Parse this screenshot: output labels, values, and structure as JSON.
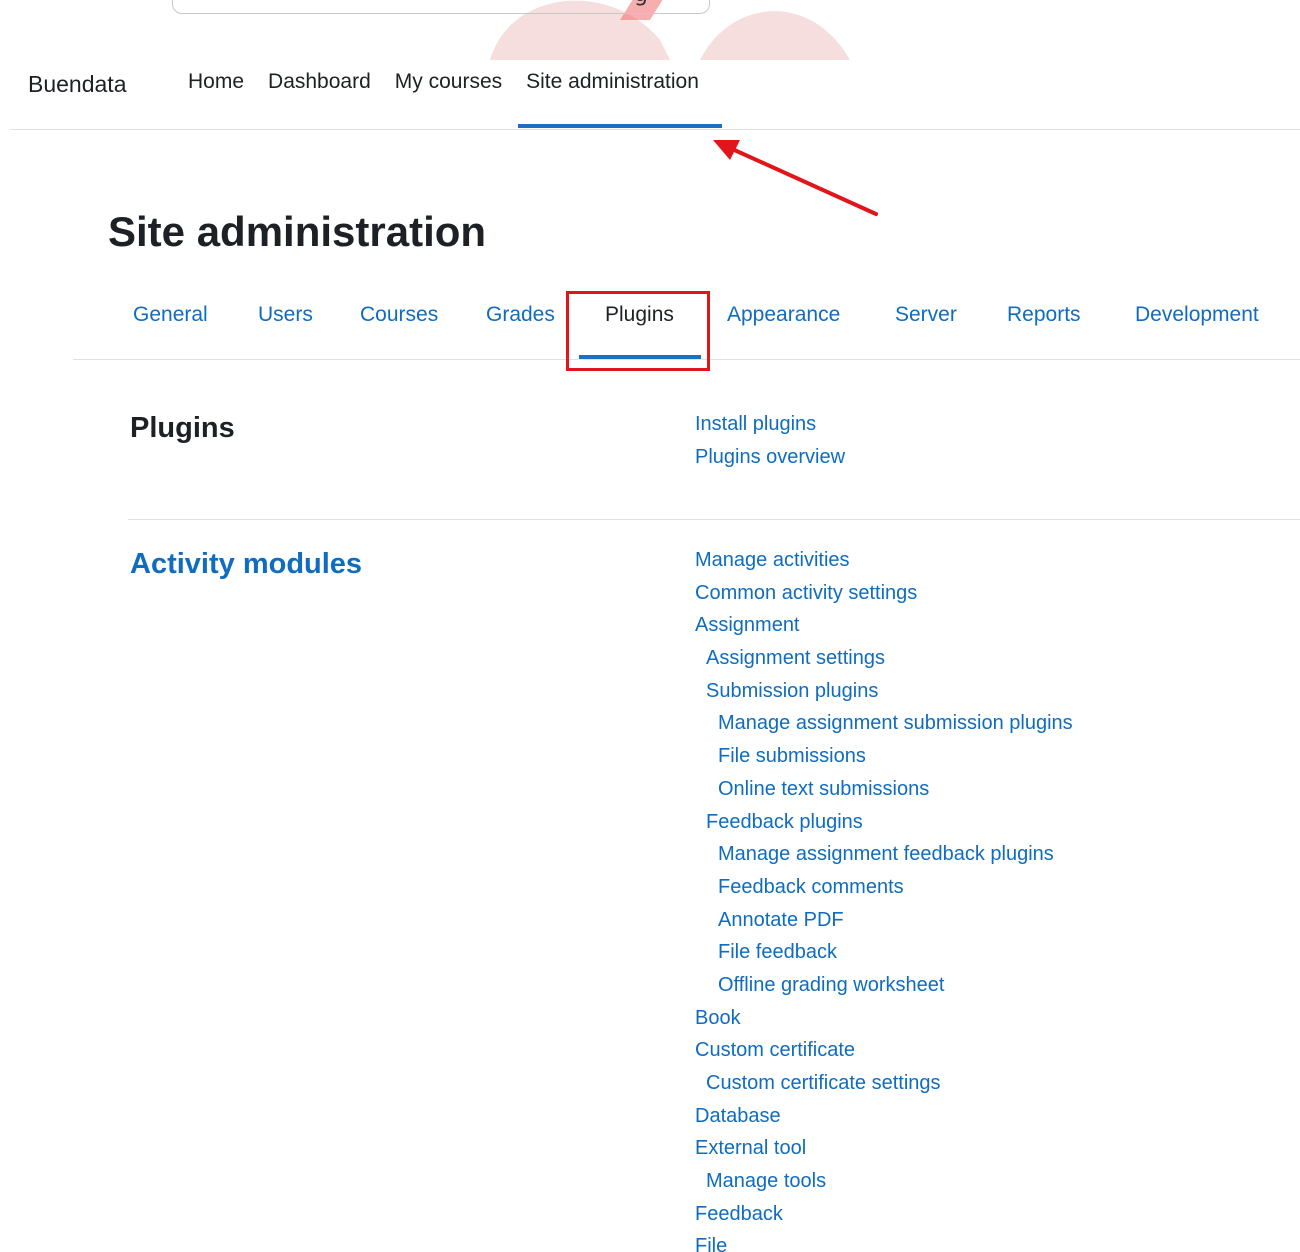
{
  "brand": "Buendata",
  "primary_nav": [
    "Home",
    "Dashboard",
    "My courses",
    "Site administration"
  ],
  "primary_nav_active": "Site administration",
  "page_title": "Site administration",
  "secondary_tabs": [
    "General",
    "Users",
    "Courses",
    "Grades",
    "Plugins",
    "Appearance",
    "Server",
    "Reports",
    "Development"
  ],
  "secondary_tab_active": "Plugins",
  "sections": [
    {
      "heading": "Plugins",
      "links": [
        {
          "label": "Install plugins",
          "level": 0
        },
        {
          "label": "Plugins overview",
          "level": 0
        }
      ]
    },
    {
      "heading": "Activity modules",
      "links": [
        {
          "label": "Manage activities",
          "level": 0
        },
        {
          "label": "Common activity settings",
          "level": 0
        },
        {
          "label": "Assignment",
          "level": 0
        },
        {
          "label": "Assignment settings",
          "level": 1
        },
        {
          "label": "Submission plugins",
          "level": 1
        },
        {
          "label": "Manage assignment submission plugins",
          "level": 2
        },
        {
          "label": "File submissions",
          "level": 2
        },
        {
          "label": "Online text submissions",
          "level": 2
        },
        {
          "label": "Feedback plugins",
          "level": 1
        },
        {
          "label": "Manage assignment feedback plugins",
          "level": 2
        },
        {
          "label": "Feedback comments",
          "level": 2
        },
        {
          "label": "Annotate PDF",
          "level": 2
        },
        {
          "label": "File feedback",
          "level": 2
        },
        {
          "label": "Offline grading worksheet",
          "level": 2
        },
        {
          "label": "Book",
          "level": 0
        },
        {
          "label": "Custom certificate",
          "level": 0
        },
        {
          "label": "Custom certificate settings",
          "level": 1
        },
        {
          "label": "Database",
          "level": 0
        },
        {
          "label": "External tool",
          "level": 0
        },
        {
          "label": "Manage tools",
          "level": 1
        },
        {
          "label": "Feedback",
          "level": 0
        },
        {
          "label": "File",
          "level": 0
        }
      ]
    }
  ],
  "colors": {
    "link": "#0f6cbf",
    "text": "#1d2125",
    "active_underline": "#1f6fbf",
    "annotation_red": "#e0161b"
  },
  "icons": {
    "annotation_arrow": "arrow-icon",
    "top_search_glyph": "g"
  }
}
